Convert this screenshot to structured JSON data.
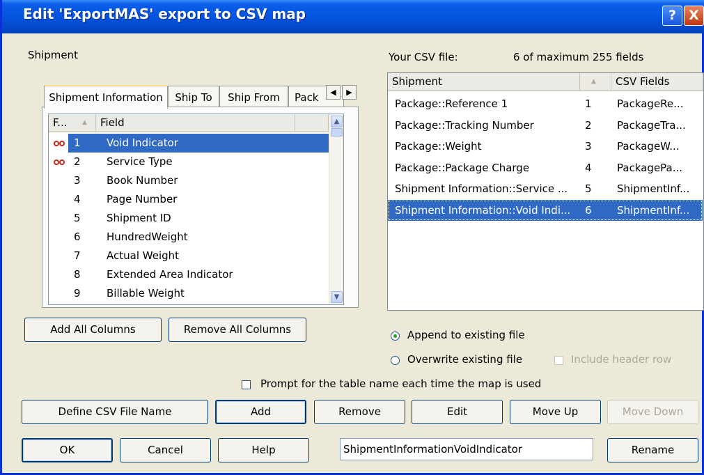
{
  "window": {
    "title": "Edit 'ExportMAS' export to CSV map",
    "help_glyph": "?",
    "close_glyph": "X"
  },
  "left": {
    "section_label": "Shipment",
    "tabs": [
      "Shipment Information",
      "Ship To",
      "Ship From",
      "Pack"
    ],
    "tab_scroll": {
      "left": "◀",
      "right": "▶"
    },
    "columns": {
      "num": "F...",
      "field": "Field",
      "sort_glyph": "▲"
    },
    "fields": [
      {
        "num": "1",
        "name": "Void Indicator",
        "linked": true,
        "selected": true
      },
      {
        "num": "2",
        "name": "Service Type",
        "linked": true,
        "selected": false
      },
      {
        "num": "3",
        "name": "Book Number",
        "linked": false,
        "selected": false
      },
      {
        "num": "4",
        "name": "Page Number",
        "linked": false,
        "selected": false
      },
      {
        "num": "5",
        "name": "Shipment ID",
        "linked": false,
        "selected": false
      },
      {
        "num": "6",
        "name": "HundredWeight",
        "linked": false,
        "selected": false
      },
      {
        "num": "7",
        "name": "Actual Weight",
        "linked": false,
        "selected": false
      },
      {
        "num": "8",
        "name": "Extended Area Indicator",
        "linked": false,
        "selected": false
      },
      {
        "num": "9",
        "name": "Billable Weight",
        "linked": false,
        "selected": false
      }
    ],
    "add_all": "Add All Columns",
    "remove_all": "Remove All Columns"
  },
  "right": {
    "csv_label": "Your CSV file:",
    "field_count": "6 of maximum 255 fields",
    "columns": {
      "shipment": "Shipment",
      "sort_glyph": "▲",
      "csv": "CSV Fields"
    },
    "rows": [
      {
        "shipment": "Package::Reference 1",
        "num": "1",
        "csv": "PackageRe...",
        "selected": false
      },
      {
        "shipment": "Package::Tracking Number",
        "num": "2",
        "csv": "PackageTra...",
        "selected": false
      },
      {
        "shipment": "Package::Weight",
        "num": "3",
        "csv": "PackageW...",
        "selected": false
      },
      {
        "shipment": "Package::Package Charge",
        "num": "4",
        "csv": "PackagePa...",
        "selected": false
      },
      {
        "shipment": "Shipment Information::Service ...",
        "num": "5",
        "csv": "ShipmentInf...",
        "selected": false
      },
      {
        "shipment": "Shipment Information::Void Indi...",
        "num": "6",
        "csv": "ShipmentInf...",
        "selected": true
      }
    ],
    "append_label": "Append to existing file",
    "overwrite_label": "Overwrite existing file",
    "append_selected": true,
    "header_row_label": "Include header row"
  },
  "prompt_label": "Prompt for the table name each time the map is used",
  "buttons": {
    "define": "Define CSV File Name",
    "add": "Add",
    "remove": "Remove",
    "edit": "Edit",
    "move_up": "Move Up",
    "move_down": "Move Down",
    "ok": "OK",
    "cancel": "Cancel",
    "help": "Help",
    "rename": "Rename"
  },
  "name_field_value": "ShipmentInformationVoidIndicator",
  "colors": {
    "selection": "#316AC5",
    "link_icon": "#C8281E",
    "title_bar": "#0454E0"
  }
}
